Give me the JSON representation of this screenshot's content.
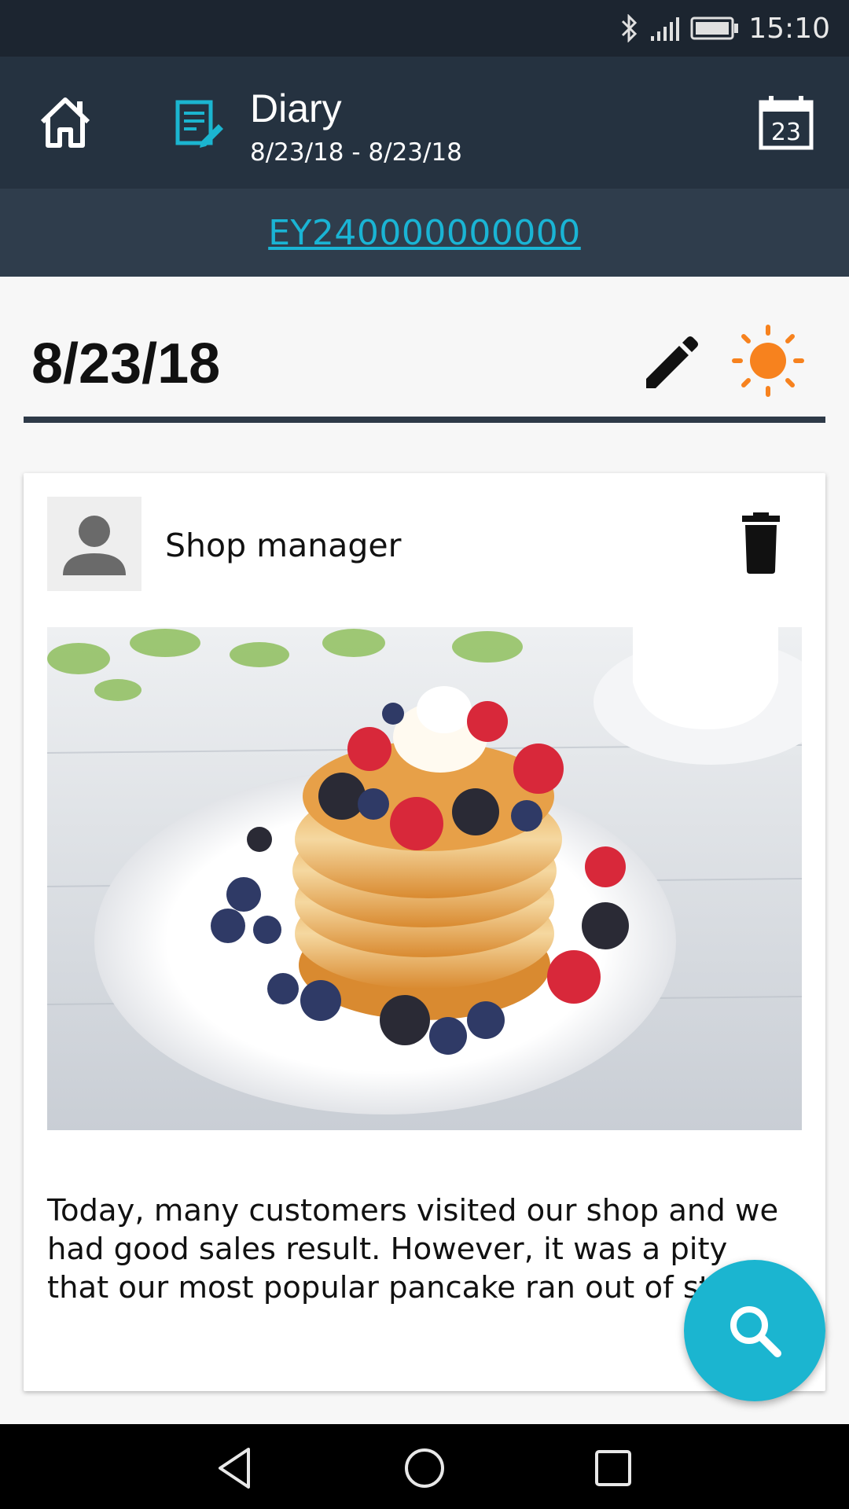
{
  "status_bar": {
    "time": "15:10",
    "icons": [
      "bluetooth-icon",
      "signal-icon",
      "battery-icon"
    ]
  },
  "app_bar": {
    "title": "Diary",
    "date_range": "8/23/18 - 8/23/18",
    "calendar_day": "23",
    "icons": [
      "home-icon",
      "diary-icon",
      "calendar-icon"
    ]
  },
  "sub_bar": {
    "link_text": "EY240000000000"
  },
  "date_header": {
    "date": "8/23/18",
    "icons": [
      "edit-icon",
      "sun-icon"
    ]
  },
  "entry": {
    "author": "Shop manager",
    "photo_alt": "pancakes-with-berries-photo",
    "text": "Today, many customers visited our shop and we had good sales result. However, it was a pity that our most popular pancake ran out of stock."
  },
  "fab": {
    "icon": "search-icon"
  },
  "nav_bar": {
    "icons": [
      "back-icon",
      "home-circle-icon",
      "recents-icon"
    ]
  },
  "colors": {
    "status_bar": "#1c2530",
    "app_bar": "#253240",
    "sub_bar": "#2f3d4c",
    "accent": "#1bb5d0",
    "sun": "#f7821e"
  }
}
